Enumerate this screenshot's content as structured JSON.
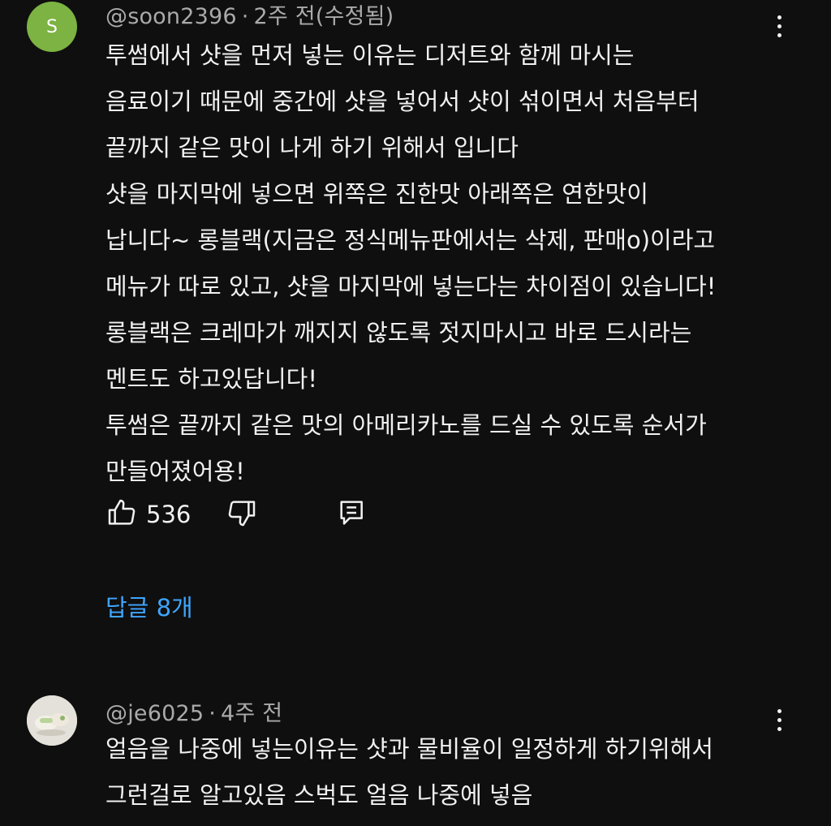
{
  "comments": [
    {
      "avatar_letter": "S",
      "avatar_color": "#7cb342",
      "handle": "@soon2396",
      "time": "2주 전(수정됨)",
      "lines": [
        "투썸에서 샷을 먼저 넣는 이유는 디저트와 함께 마시는",
        "음료이기 때문에 중간에 샷을 넣어서 샷이 섞이면서 처음부터",
        "끝까지 같은 맛이 나게 하기 위해서 입니다",
        "샷을 마지막에 넣으면 위쪽은 진한맛 아래쪽은 연한맛이",
        "납니다~ 롱블랙(지금은 정식메뉴판에서는 삭제, 판매o)이라고",
        "메뉴가 따로 있고, 샷을 마지막에 넣는다는 차이점이 있습니다!",
        "롱블랙은 크레마가 깨지지 않도록 젓지마시고 바로 드시라는",
        "멘트도 하고있답니다!",
        "투썸은 끝까지 같은 맛의 아메리카노를 드실 수 있도록 순서가",
        "만들어졌어용!"
      ],
      "like_count": "536",
      "replies_label": "답글 8개"
    },
    {
      "handle": "@je6025",
      "time": "4주 전",
      "lines": [
        "얼음을 나중에 넣는이유는 샷과 물비율이 일정하게 하기위해서",
        "그런걸로 알고있음 스벅도 얼음 나중에 넣음"
      ]
    }
  ],
  "colors": {
    "background": "#0f0f0f",
    "text": "#f1f1f1",
    "meta": "#aaaaaa",
    "link": "#3ea6ff"
  },
  "icons": [
    "like-icon",
    "dislike-icon",
    "reply-icon",
    "more-vert-icon"
  ]
}
